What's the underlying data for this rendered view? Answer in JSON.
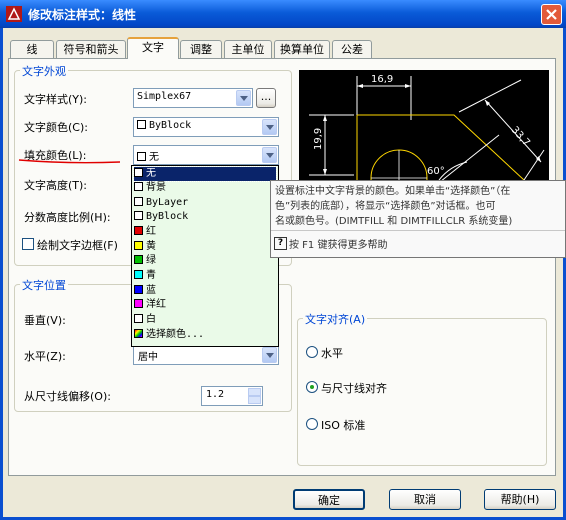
{
  "window": {
    "title": "修改标注样式：线性"
  },
  "tabs": [
    {
      "label": "线"
    },
    {
      "label": "符号和箭头"
    },
    {
      "label": "文字"
    },
    {
      "label": "调整"
    },
    {
      "label": "主单位"
    },
    {
      "label": "换算单位"
    },
    {
      "label": "公差"
    }
  ],
  "appearance": {
    "group_title": "文字外观",
    "text_style_label": "文字样式(Y):",
    "text_style_value": "Simplex67",
    "browse_label": "...",
    "text_color_label": "文字颜色(C):",
    "text_color_value": "ByBlock",
    "fill_color_label": "填充颜色(L):",
    "fill_color_value": "无",
    "text_height_label": "文字高度(T):",
    "fraction_height_label": "分数高度比例(H):",
    "draw_frame_label": "绘制文字边框(F)"
  },
  "colors": {
    "red": "#e00000",
    "yellow": "#ffff00",
    "green": "#00c000",
    "cyan": "#00ffff",
    "blue": "#0000ff",
    "magenta": "#ff00ff",
    "white": "#ffffff",
    "underline": "#e00000",
    "preview_bg": "#000000",
    "preview_line": "#ffffff",
    "preview_accent": "#ffd700"
  },
  "fill_dropdown": {
    "items": [
      {
        "label": "无",
        "swatch": "#ffffff",
        "selected": true
      },
      {
        "label": "背景",
        "swatch": "#ffffff"
      },
      {
        "label": "ByLayer",
        "swatch": "#ffffff"
      },
      {
        "label": "ByBlock",
        "swatch": "#ffffff"
      },
      {
        "label": "红",
        "swatch": "#e00000"
      },
      {
        "label": "黄",
        "swatch": "#ffff00"
      },
      {
        "label": "绿",
        "swatch": "#00c000"
      },
      {
        "label": "青",
        "swatch": "#00ffff"
      },
      {
        "label": "蓝",
        "swatch": "#0000ff"
      },
      {
        "label": "洋红",
        "swatch": "#ff00ff"
      },
      {
        "label": "白",
        "swatch": "#ffffff"
      },
      {
        "label": "选择颜色...",
        "swatch": "multi"
      }
    ]
  },
  "tooltip": {
    "line1": "设置标注中文字背景的颜色。如果单击“选择颜色”（在",
    "line2": "色”列表的底部），将显示“选择颜色”对话框。也可",
    "line3": "名或颜色号。(DIMTFILL 和 DIMTFILLCLR 系统变量)",
    "help_text": "按 F1 键获得更多帮助",
    "help_icon": "?"
  },
  "preview": {
    "dim_top": "16,9",
    "dim_left": "19,9",
    "dim_diag": "33,7",
    "angle": "60°"
  },
  "position": {
    "group_title": "文字位置",
    "vertical_label": "垂直(V):",
    "horizontal_label": "水平(Z):",
    "horizontal_value": "居中",
    "offset_label": "从尺寸线偏移(O):",
    "offset_value": "1.2"
  },
  "alignment": {
    "group_title": "文字对齐(A)",
    "options": [
      {
        "label": "水平",
        "checked": false
      },
      {
        "label": "与尺寸线对齐",
        "checked": true
      },
      {
        "label": "ISO 标准",
        "checked": false
      }
    ]
  },
  "buttons": {
    "ok": "确定",
    "cancel": "取消",
    "help": "帮助(H)"
  }
}
